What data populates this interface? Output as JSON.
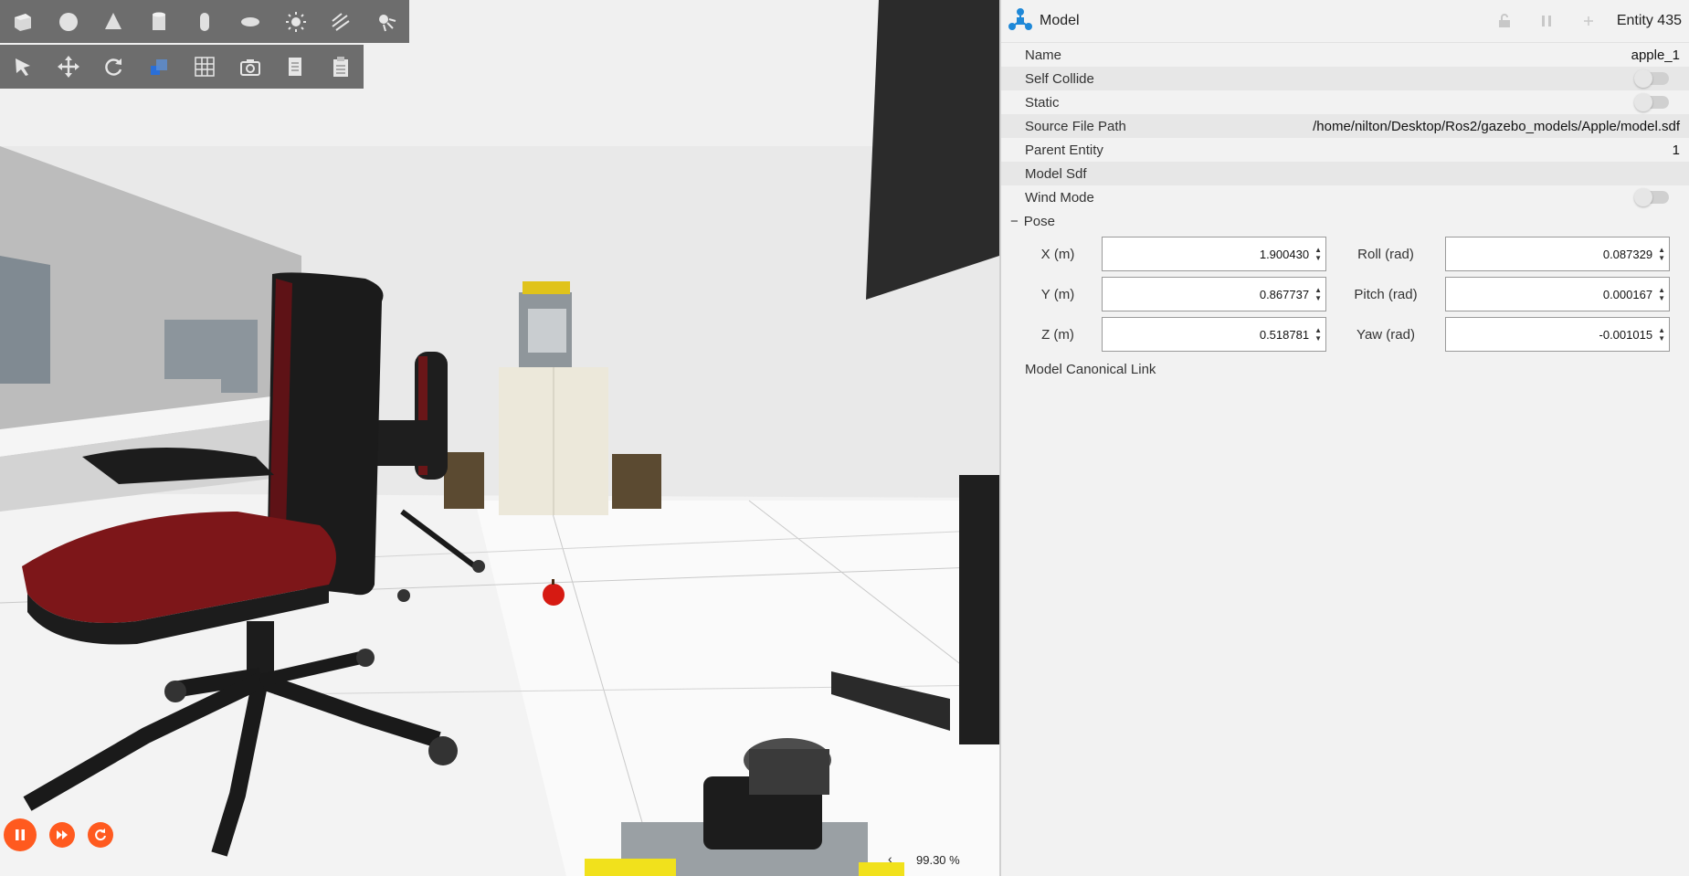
{
  "viewport": {
    "shapes_toolbar": [
      "box-icon",
      "sphere-icon",
      "cone-icon",
      "cylinder-icon",
      "capsule-icon",
      "ellipsoid-icon",
      "sun-icon",
      "directional-light-icon",
      "spot-light-icon"
    ],
    "tools_toolbar": [
      "select-arrow-icon",
      "translate-icon",
      "rotate-icon",
      "scale-icon",
      "grid-icon",
      "camera-icon",
      "copy-icon",
      "paste-icon"
    ],
    "playback": {
      "pause_icon": "pause-icon",
      "step_icon": "fast-forward-icon",
      "reset_icon": "reset-icon"
    },
    "rtf_arrow": "‹",
    "real_time_factor": "99.30 %"
  },
  "panel": {
    "title": "Model",
    "entity": "Entity 435",
    "properties": [
      {
        "label": "Name",
        "value": "apple_1",
        "type": "text"
      },
      {
        "label": "Self Collide",
        "value": "",
        "type": "toggle"
      },
      {
        "label": "Static",
        "value": "",
        "type": "toggle"
      },
      {
        "label": "Source File Path",
        "value": "/home/nilton/Desktop/Ros2/gazebo_models/Apple/model.sdf",
        "type": "text"
      },
      {
        "label": "Parent Entity",
        "value": "1",
        "type": "text"
      },
      {
        "label": "Model Sdf",
        "value": "",
        "type": "text"
      },
      {
        "label": "Wind Mode",
        "value": "",
        "type": "toggle"
      }
    ],
    "pose": {
      "title": "Pose",
      "collapse": "−",
      "x_label": "X (m)",
      "x": "1.900430",
      "y_label": "Y (m)",
      "y": "0.867737",
      "z_label": "Z (m)",
      "z": "0.518781",
      "roll_label": "Roll (rad)",
      "roll": "0.087329",
      "pitch_label": "Pitch (rad)",
      "pitch": "0.000167",
      "yaw_label": "Yaw (rad)",
      "yaw": "-0.001015"
    },
    "canonical_link": "Model Canonical Link"
  },
  "colors": {
    "accent": "#ff5a1f",
    "toolbar": "#6d6d6d",
    "panel": "#f2f2f2",
    "apple": "#d61a12",
    "chair_red": "#7d1619"
  }
}
